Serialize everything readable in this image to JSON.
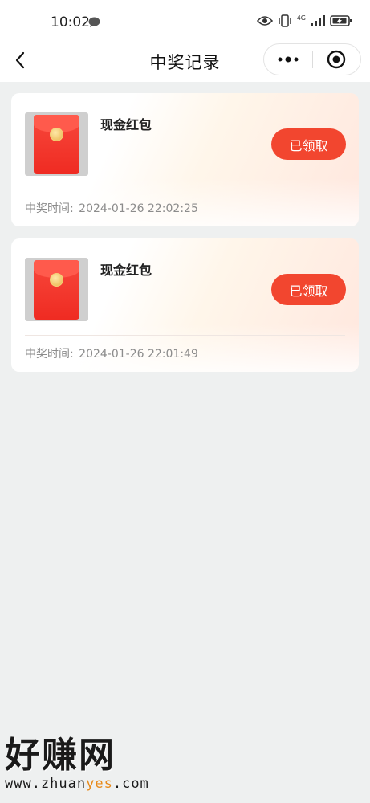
{
  "status_bar": {
    "time": "10:02",
    "icons": [
      "message-icon",
      "eye-icon",
      "vibrate-icon",
      "signal-4g-icon",
      "battery-icon"
    ],
    "network_label": "4G"
  },
  "navbar": {
    "title": "中奖记录",
    "back_icon": "chevron-left-icon",
    "capsule_icons": [
      "more-icon",
      "target-close-icon"
    ]
  },
  "records": [
    {
      "prize_name": "现金红包",
      "status_label": "已领取",
      "time_label": "中奖时间:",
      "time_value": "2024-01-26 22:02:25"
    },
    {
      "prize_name": "现金红包",
      "status_label": "已领取",
      "time_label": "中奖时间:",
      "time_value": "2024-01-26 22:01:49"
    }
  ],
  "watermark": {
    "big_text": "好赚网",
    "url_prefix": "www.zhuan",
    "url_accent": "yes",
    "url_suffix": ".com"
  },
  "colors": {
    "accent": "#f2462f",
    "page_bg": "#eef0f0",
    "muted_text": "#8c8c8c"
  }
}
